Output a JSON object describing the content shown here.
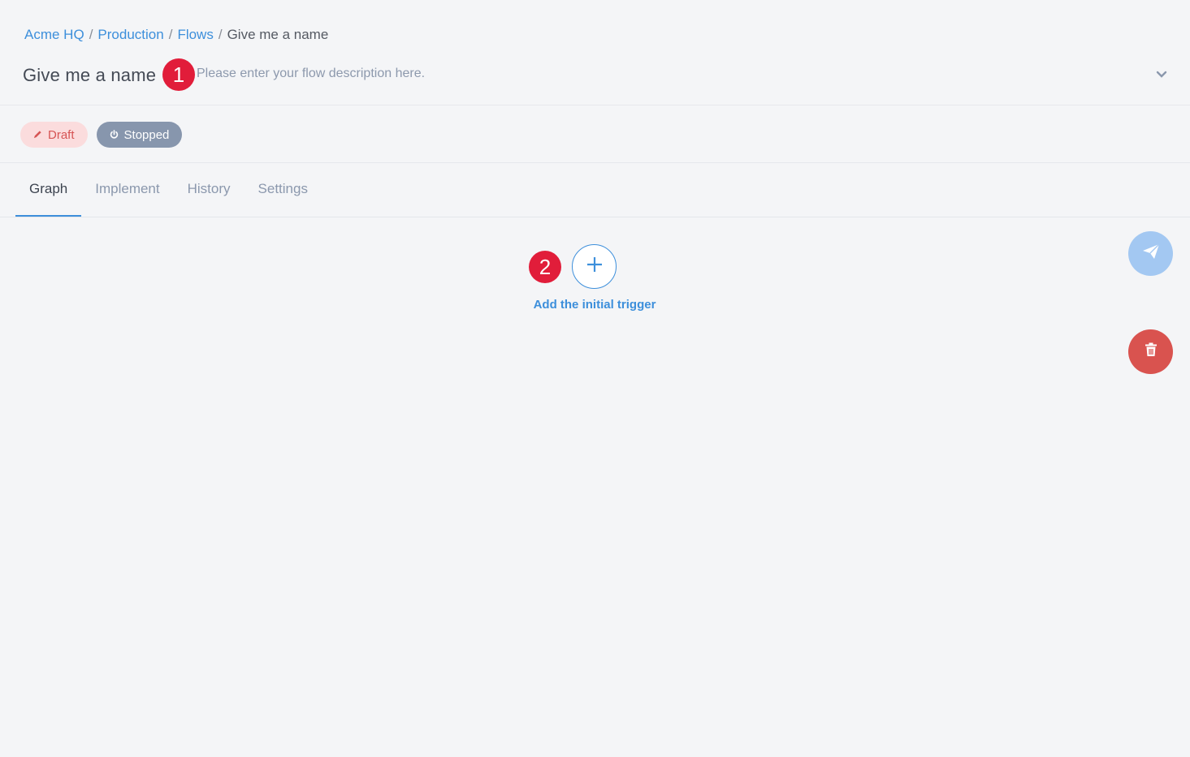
{
  "breadcrumb": {
    "items": [
      "Acme HQ",
      "Production",
      "Flows"
    ],
    "separator": "/",
    "current": "Give me a name"
  },
  "flow": {
    "title": "Give me a name",
    "description_placeholder": "Please enter your flow description here."
  },
  "markers": {
    "one": "1",
    "two": "2"
  },
  "badges": {
    "draft": "Draft",
    "stopped": "Stopped"
  },
  "tabs": [
    {
      "label": "Graph",
      "active": true
    },
    {
      "label": "Implement",
      "active": false
    },
    {
      "label": "History",
      "active": false
    },
    {
      "label": "Settings",
      "active": false
    }
  ],
  "canvas": {
    "add_trigger_label": "Add the initial trigger"
  },
  "colors": {
    "accent": "#3d8fdb",
    "marker": "#e11d3a",
    "draft_bg": "#fbdcdd",
    "draft_text": "#d65454",
    "stopped_bg": "#8796ad",
    "publish": "#a3c8f2",
    "delete": "#d9534f"
  },
  "icons": {
    "edit": "pencil-icon",
    "expand": "chevron-down-icon",
    "power": "power-icon",
    "add": "plus-icon",
    "publish": "paper-plane-icon",
    "delete": "trash-icon"
  }
}
